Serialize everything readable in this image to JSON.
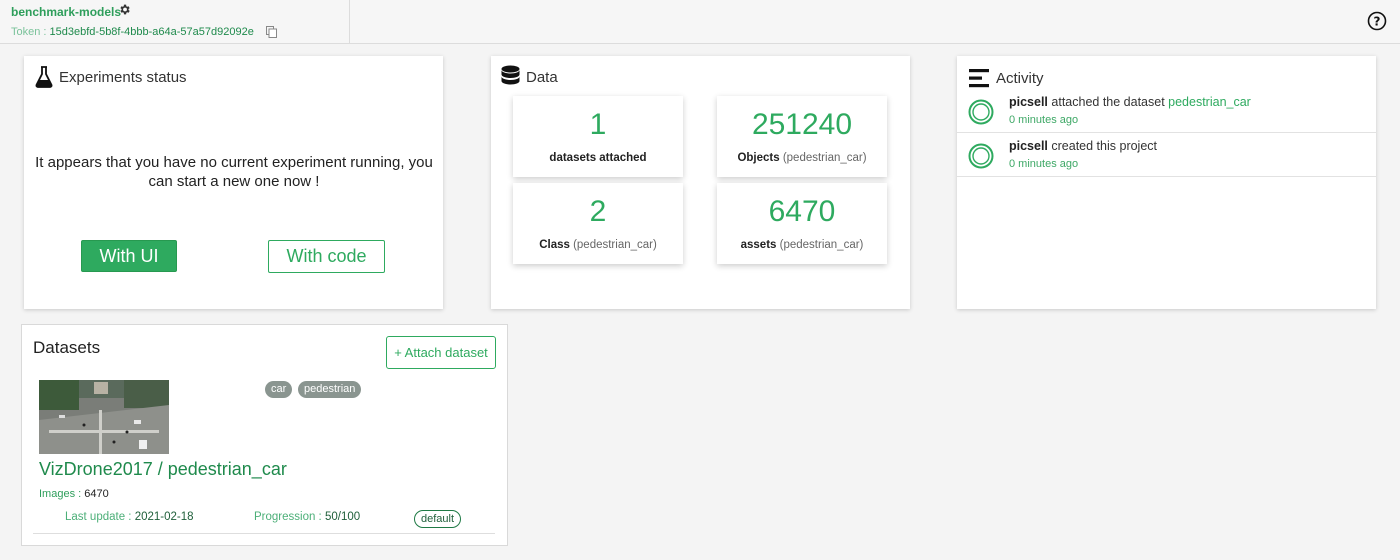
{
  "project": {
    "name": "benchmark-models",
    "token_label": "Token : ",
    "token_value": "15d3ebfd-5b8f-4bbb-a64a-57a57d92092e"
  },
  "experiments": {
    "title": "Experiments status",
    "message": "It appears that you have no current experiment running, you can start a new one now !",
    "btn_ui": "With UI",
    "btn_code": "With code"
  },
  "data": {
    "title": "Data",
    "stats": [
      {
        "value": "1",
        "label": "datasets attached",
        "sub": ""
      },
      {
        "value": "251240",
        "label": "Objects",
        "sub": "(pedestrian_car)"
      },
      {
        "value": "2",
        "label": "Class",
        "sub": "(pedestrian_car)"
      },
      {
        "value": "6470",
        "label": "assets",
        "sub": "(pedestrian_car)"
      }
    ]
  },
  "activity": {
    "title": "Activity",
    "items": [
      {
        "user": "picsell",
        "action": " attached the dataset ",
        "link": "pedestrian_car",
        "time": "0 minutes ago"
      },
      {
        "user": "picsell",
        "action": " created this project",
        "link": "",
        "time": "0 minutes ago"
      }
    ]
  },
  "datasets": {
    "title": "Datasets",
    "attach_label": "+ Attach dataset",
    "items": [
      {
        "name": "VizDrone2017 / pedestrian_car",
        "tags": [
          "car",
          "pedestrian"
        ],
        "images_label": "Images : ",
        "images_value": "6470",
        "last_update_label": "Last update : ",
        "last_update_value": "2021-02-18",
        "progression_label": "Progression : ",
        "progression_value": "50/100",
        "badge": "default"
      }
    ]
  },
  "colors": {
    "accent": "#2eaa5f",
    "dark_accent": "#1f8a4c",
    "tag": "#8a9590"
  },
  "icons": [
    "gear-icon",
    "copy-icon",
    "help-icon",
    "flask-icon",
    "database-icon",
    "activity-list-icon",
    "activity-circle-icon"
  ]
}
